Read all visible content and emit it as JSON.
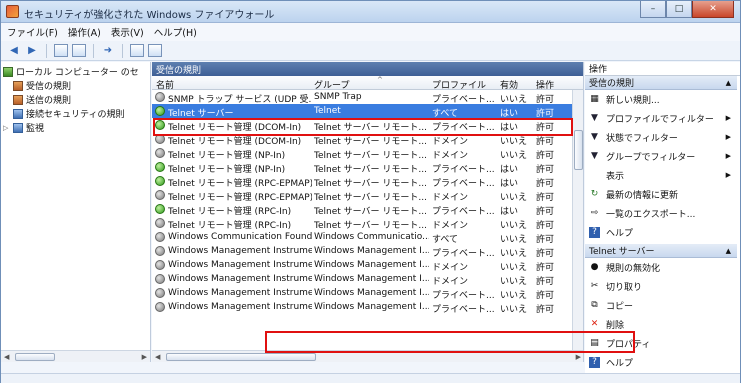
{
  "window": {
    "title": "セキュリティが強化された Windows ファイアウォール",
    "buttons": [
      "–",
      "□",
      "✕"
    ]
  },
  "menu": [
    "ファイル(F)",
    "操作(A)",
    "表示(V)",
    "ヘルプ(H)"
  ],
  "toolbar_icons": [
    "back-arrow-icon",
    "forward-arrow-icon",
    "folder-icon",
    "properties-icon",
    "export-icon",
    "help-icon",
    "view-icon"
  ],
  "tree": {
    "root": "ローカル コンピューター のセ",
    "items": [
      "受信の規則",
      "送信の規則",
      "接続セキュリティの規則",
      "監視"
    ]
  },
  "center": {
    "header": "受信の規則",
    "columns": [
      "名前",
      "グループ",
      "プロファイル",
      "有効",
      "操作"
    ],
    "rows": [
      {
        "name": "SNMP トラップ サービス (UDP 受...",
        "group": "SNMP Trap",
        "profile": "プライベート...",
        "enabled": "いいえ",
        "action": "許可",
        "status": "gray",
        "selected": false
      },
      {
        "name": "Telnet サーバー",
        "group": "Telnet",
        "profile": "すべて",
        "enabled": "はい",
        "action": "許可",
        "status": "green",
        "selected": true
      },
      {
        "name": "Telnet リモート管理 (DCOM-In)",
        "group": "Telnet サーバー リモート...",
        "profile": "プライベート...",
        "enabled": "はい",
        "action": "許可",
        "status": "green",
        "selected": false
      },
      {
        "name": "Telnet リモート管理 (DCOM-In)",
        "group": "Telnet サーバー リモート...",
        "profile": "ドメイン",
        "enabled": "いいえ",
        "action": "許可",
        "status": "gray",
        "selected": false
      },
      {
        "name": "Telnet リモート管理 (NP-In)",
        "group": "Telnet サーバー リモート...",
        "profile": "ドメイン",
        "enabled": "いいえ",
        "action": "許可",
        "status": "gray",
        "selected": false
      },
      {
        "name": "Telnet リモート管理 (NP-In)",
        "group": "Telnet サーバー リモート...",
        "profile": "プライベート...",
        "enabled": "はい",
        "action": "許可",
        "status": "green",
        "selected": false
      },
      {
        "name": "Telnet リモート管理 (RPC-EPMAP)",
        "group": "Telnet サーバー リモート...",
        "profile": "プライベート...",
        "enabled": "はい",
        "action": "許可",
        "status": "green",
        "selected": false
      },
      {
        "name": "Telnet リモート管理 (RPC-EPMAP)",
        "group": "Telnet サーバー リモート...",
        "profile": "ドメイン",
        "enabled": "いいえ",
        "action": "許可",
        "status": "gray",
        "selected": false
      },
      {
        "name": "Telnet リモート管理 (RPC-In)",
        "group": "Telnet サーバー リモート...",
        "profile": "プライベート...",
        "enabled": "はい",
        "action": "許可",
        "status": "green",
        "selected": false
      },
      {
        "name": "Telnet リモート管理 (RPC-In)",
        "group": "Telnet サーバー リモート...",
        "profile": "ドメイン",
        "enabled": "いいえ",
        "action": "許可",
        "status": "gray",
        "selected": false
      },
      {
        "name": "Windows Communication Found...",
        "group": "Windows Communicatio...",
        "profile": "すべて",
        "enabled": "いいえ",
        "action": "許可",
        "status": "gray",
        "selected": false
      },
      {
        "name": "Windows Management Instrume...",
        "group": "Windows Management I...",
        "profile": "プライベート...",
        "enabled": "いいえ",
        "action": "許可",
        "status": "gray",
        "selected": false
      },
      {
        "name": "Windows Management Instrume...",
        "group": "Windows Management I...",
        "profile": "ドメイン",
        "enabled": "いいえ",
        "action": "許可",
        "status": "gray",
        "selected": false
      },
      {
        "name": "Windows Management Instrume...",
        "group": "Windows Management I...",
        "profile": "ドメイン",
        "enabled": "いいえ",
        "action": "許可",
        "status": "gray",
        "selected": false
      },
      {
        "name": "Windows Management Instrume...",
        "group": "Windows Management I...",
        "profile": "プライベート...",
        "enabled": "いいえ",
        "action": "許可",
        "status": "gray",
        "selected": false
      },
      {
        "name": "Windows Management Instrume...",
        "group": "Windows Management I...",
        "profile": "プライベート...",
        "enabled": "いいえ",
        "action": "許可",
        "status": "gray",
        "selected": false
      }
    ]
  },
  "actions": {
    "header": "操作",
    "section1": {
      "title": "受信の規則",
      "items": [
        {
          "label": "新しい規則...",
          "icon": "new-rule-icon",
          "submenu": false
        },
        {
          "label": "プロファイルでフィルター",
          "icon": "filter-icon",
          "submenu": true
        },
        {
          "label": "状態でフィルター",
          "icon": "filter-icon",
          "submenu": true
        },
        {
          "label": "グループでフィルター",
          "icon": "filter-icon",
          "submenu": true
        },
        {
          "label": "表示",
          "icon": "",
          "submenu": true
        },
        {
          "label": "最新の情報に更新",
          "icon": "refresh-icon",
          "submenu": false
        },
        {
          "label": "一覧のエクスポート...",
          "icon": "export-icon",
          "submenu": false
        },
        {
          "label": "ヘルプ",
          "icon": "help-icon",
          "submenu": false
        }
      ]
    },
    "section2": {
      "title": "Telnet サーバー",
      "items": [
        {
          "label": "規則の無効化",
          "icon": "disable-icon"
        },
        {
          "label": "切り取り",
          "icon": "cut-icon"
        },
        {
          "label": "コピー",
          "icon": "copy-icon"
        },
        {
          "label": "削除",
          "icon": "delete-icon"
        },
        {
          "label": "プロパティ",
          "icon": "properties-icon"
        },
        {
          "label": "ヘルプ",
          "icon": "help-icon"
        }
      ]
    }
  },
  "colors": {
    "selection": "#3a7de0",
    "highlight": "#e01010",
    "header": "#3f5f95"
  }
}
